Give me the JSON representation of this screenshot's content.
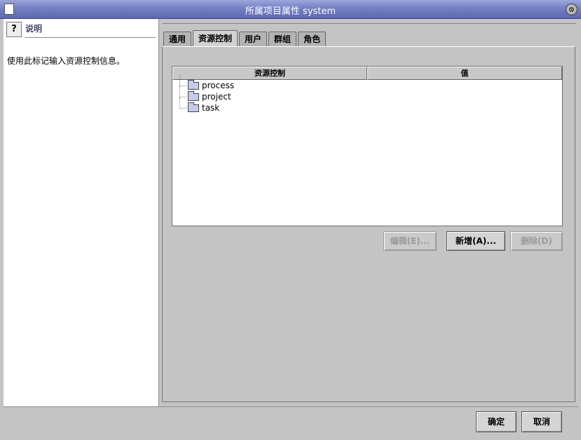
{
  "window": {
    "title": "所属项目属性 system",
    "close_glyph": "⊗"
  },
  "help": {
    "icon_glyph": "?",
    "title": "说明",
    "text": "使用此标记输入资源控制信息。"
  },
  "tabs": [
    {
      "label": "通用",
      "active": false
    },
    {
      "label": "资源控制",
      "active": true
    },
    {
      "label": "用户",
      "active": false
    },
    {
      "label": "群组",
      "active": false
    },
    {
      "label": "角色",
      "active": false
    }
  ],
  "table": {
    "columns": [
      "资源控制",
      "值"
    ],
    "rows": [
      {
        "label": "process",
        "value": ""
      },
      {
        "label": "project",
        "value": ""
      },
      {
        "label": "task",
        "value": ""
      }
    ]
  },
  "actions": {
    "edit": "编辑(E)...",
    "add": "新增(A)...",
    "delete": "删除(D)"
  },
  "footer": {
    "ok": "确定",
    "cancel": "取消"
  },
  "colors": {
    "titlebar": "#7580c4",
    "folder": "#c4cbf0",
    "background": "#c4c4c4"
  }
}
